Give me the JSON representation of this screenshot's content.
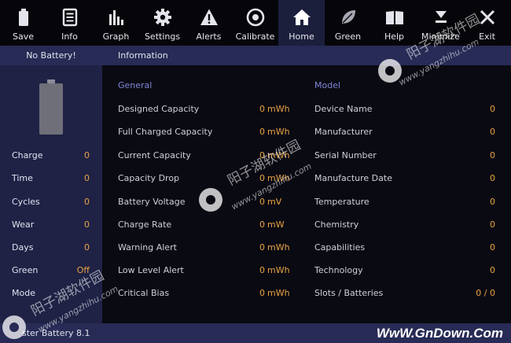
{
  "toolbar": {
    "items": [
      {
        "label": "Save",
        "icon": "battery-icon"
      },
      {
        "label": "Info",
        "icon": "document-icon"
      },
      {
        "label": "Graph",
        "icon": "bar-graph-icon"
      },
      {
        "label": "Settings",
        "icon": "gear-icon"
      },
      {
        "label": "Alerts",
        "icon": "warning-icon"
      },
      {
        "label": "Calibrate",
        "icon": "target-icon"
      },
      {
        "label": "Home",
        "icon": "home-icon"
      },
      {
        "label": "Green",
        "icon": "leaf-icon"
      },
      {
        "label": "Help",
        "icon": "book-icon"
      },
      {
        "label": "Minimize",
        "icon": "minimize-icon"
      },
      {
        "label": "Exit",
        "icon": "close-icon"
      }
    ],
    "active": "Home"
  },
  "header": {
    "status": "No Battery!",
    "section_title": "Information"
  },
  "left_panel": {
    "stats": [
      {
        "label": "Charge",
        "value": "0"
      },
      {
        "label": "Time",
        "value": "0"
      },
      {
        "label": "Cycles",
        "value": "0"
      },
      {
        "label": "Wear",
        "value": "0"
      },
      {
        "label": "Days",
        "value": "0"
      },
      {
        "label": "Green",
        "value": "Off"
      },
      {
        "label": "Mode",
        "value": ""
      }
    ]
  },
  "general": {
    "title": "General",
    "rows": [
      {
        "label": "Designed Capacity",
        "value": "0",
        "unit": "mWh"
      },
      {
        "label": "Full Charged Capacity",
        "value": "0",
        "unit": "mWh"
      },
      {
        "label": "Current Capacity",
        "value": "0",
        "unit": "mWh"
      },
      {
        "label": "Capacity Drop",
        "value": "0",
        "unit": "mWh"
      },
      {
        "label": "Battery Voltage",
        "value": "0",
        "unit": "mV"
      },
      {
        "label": "Charge Rate",
        "value": "0",
        "unit": "mW"
      },
      {
        "label": "Warning Alert",
        "value": "0",
        "unit": "mWh"
      },
      {
        "label": "Low Level Alert",
        "value": "0",
        "unit": "mWh"
      },
      {
        "label": "Critical Bias",
        "value": "0",
        "unit": "mWh"
      }
    ]
  },
  "model": {
    "title": "Model",
    "rows": [
      {
        "label": "Device Name",
        "value": "0"
      },
      {
        "label": "Manufacturer",
        "value": "0"
      },
      {
        "label": "Serial Number",
        "value": "0"
      },
      {
        "label": "Manufacture Date",
        "value": "0"
      },
      {
        "label": "Temperature",
        "value": "0"
      },
      {
        "label": "Chemistry",
        "value": "0"
      },
      {
        "label": "Capabilities",
        "value": "0"
      },
      {
        "label": "Technology",
        "value": "0"
      },
      {
        "label": "Slots / Batteries",
        "value": "0 / 0"
      }
    ]
  },
  "footer": {
    "app_name": "ster Battery 8.1",
    "site_watermark": "WwW.GnDown.Com"
  },
  "watermarks": {
    "cn_text": "阳子湖软件园",
    "url_text": "www.yangzhihu.com"
  },
  "colors": {
    "accent_value": "#e9a246",
    "section_title": "#7f86d4",
    "panel_bg": "#1f2245",
    "strip_bg": "#272b55",
    "active_tab_bg": "#1c1f3c"
  }
}
